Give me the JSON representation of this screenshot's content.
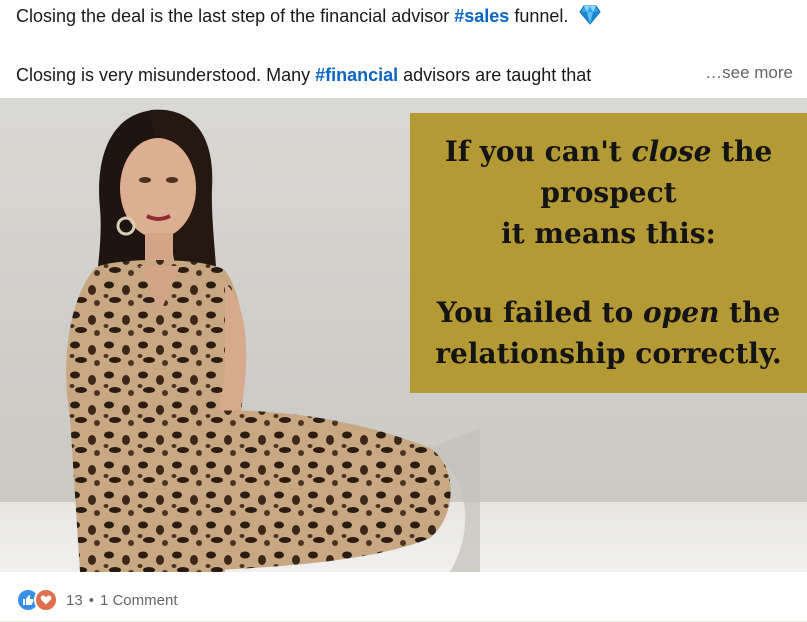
{
  "post": {
    "line1_before": "Closing the deal is the last step of the financial advisor ",
    "line1_hashtag": "#sales",
    "line1_after": " funnel.",
    "line2_before": "Closing is very misunderstood. Many ",
    "line2_hashtag": "#financial",
    "line2_after": " advisors are taught that",
    "see_more": "…see more"
  },
  "image": {
    "card_line1_a": "If you can't ",
    "card_line1_em": "close",
    "card_line1_b": " the",
    "card_line2": "prospect",
    "card_line3": "it means this:",
    "card_line4_a": "You failed to ",
    "card_line4_em": "open",
    "card_line4_b": " the",
    "card_line5": "relationship correctly.",
    "card_color": "#b39a34"
  },
  "social": {
    "reaction_count": "13",
    "separator": "•",
    "comments": "1 Comment"
  },
  "icons": {
    "diamond": "gem-icon",
    "like": "like-reaction-icon",
    "love": "love-reaction-icon"
  }
}
